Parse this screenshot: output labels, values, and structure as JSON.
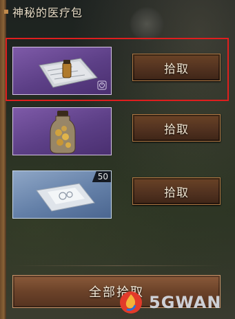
{
  "panel": {
    "title": "神秘的医疗包"
  },
  "items": [
    {
      "name": "medkit-package",
      "rarity": "purple",
      "pick_label": "拾取",
      "selected": true,
      "has_timer": true
    },
    {
      "name": "pill-jar",
      "rarity": "purple",
      "pick_label": "拾取",
      "selected": false
    },
    {
      "name": "bandage-pack",
      "rarity": "blue",
      "pick_label": "拾取",
      "selected": false,
      "count": "50"
    }
  ],
  "footer": {
    "pick_all_label": "全部拾取"
  },
  "watermark": {
    "text": "5GWAN"
  },
  "colors": {
    "highlight": "#e01e1e",
    "rarity_purple": "#5c3f86",
    "rarity_blue": "#6480a8",
    "button_fill": "#523220"
  }
}
